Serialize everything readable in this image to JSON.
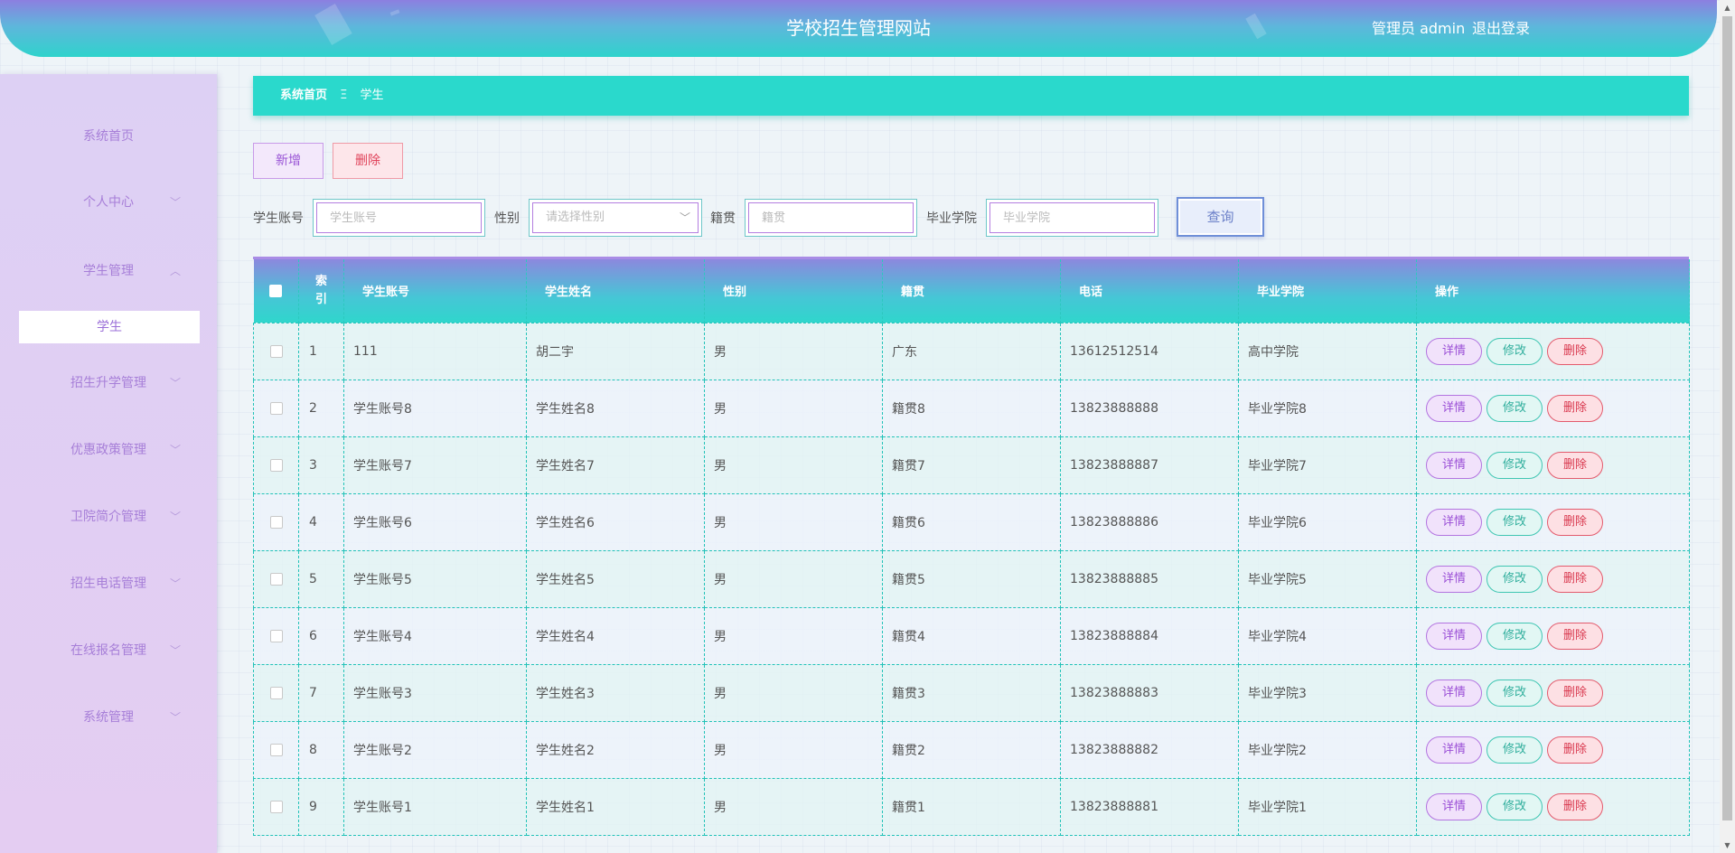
{
  "header": {
    "title": "学校招生管理网站",
    "user": "管理员 admin",
    "logout": "退出登录"
  },
  "sidebar": {
    "items": [
      {
        "label": "系统首页",
        "expandable": false
      },
      {
        "label": "个人中心",
        "expandable": true,
        "expanded": false
      },
      {
        "label": "学生管理",
        "expandable": true,
        "expanded": true
      },
      {
        "label": "招生升学管理",
        "expandable": true,
        "expanded": false
      },
      {
        "label": "优惠政策管理",
        "expandable": true,
        "expanded": false
      },
      {
        "label": "卫院简介管理",
        "expandable": true,
        "expanded": false
      },
      {
        "label": "招生电话管理",
        "expandable": true,
        "expanded": false
      },
      {
        "label": "在线报名管理",
        "expandable": true,
        "expanded": false
      },
      {
        "label": "系统管理",
        "expandable": true,
        "expanded": false
      }
    ],
    "active_sub": "学生"
  },
  "breadcrumb": {
    "home": "系统首页",
    "separator": "Ξ",
    "current": "学生"
  },
  "actions": {
    "add": "新增",
    "delete": "删除"
  },
  "search": {
    "account_label": "学生账号",
    "account_placeholder": "学生账号",
    "gender_label": "性别",
    "gender_placeholder": "请选择性别",
    "native_label": "籍贯",
    "native_placeholder": "籍贯",
    "college_label": "毕业学院",
    "college_placeholder": "毕业学院",
    "query": "查询"
  },
  "table": {
    "columns": {
      "index": "索引",
      "account": "学生账号",
      "name": "学生姓名",
      "gender": "性别",
      "native": "籍贯",
      "phone": "电话",
      "college": "毕业学院",
      "ops": "操作"
    },
    "ops": {
      "detail": "详情",
      "edit": "修改",
      "remove": "删除"
    },
    "rows": [
      {
        "index": "1",
        "account": "111",
        "name": "胡二宇",
        "gender": "男",
        "native": "广东",
        "phone": "13612512514",
        "college": "高中学院"
      },
      {
        "index": "2",
        "account": "学生账号8",
        "name": "学生姓名8",
        "gender": "男",
        "native": "籍贯8",
        "phone": "13823888888",
        "college": "毕业学院8"
      },
      {
        "index": "3",
        "account": "学生账号7",
        "name": "学生姓名7",
        "gender": "男",
        "native": "籍贯7",
        "phone": "13823888887",
        "college": "毕业学院7"
      },
      {
        "index": "4",
        "account": "学生账号6",
        "name": "学生姓名6",
        "gender": "男",
        "native": "籍贯6",
        "phone": "13823888886",
        "college": "毕业学院6"
      },
      {
        "index": "5",
        "account": "学生账号5",
        "name": "学生姓名5",
        "gender": "男",
        "native": "籍贯5",
        "phone": "13823888885",
        "college": "毕业学院5"
      },
      {
        "index": "6",
        "account": "学生账号4",
        "name": "学生姓名4",
        "gender": "男",
        "native": "籍贯4",
        "phone": "13823888884",
        "college": "毕业学院4"
      },
      {
        "index": "7",
        "account": "学生账号3",
        "name": "学生姓名3",
        "gender": "男",
        "native": "籍贯3",
        "phone": "13823888883",
        "college": "毕业学院3"
      },
      {
        "index": "8",
        "account": "学生账号2",
        "name": "学生姓名2",
        "gender": "男",
        "native": "籍贯2",
        "phone": "13823888882",
        "college": "毕业学院2"
      },
      {
        "index": "9",
        "account": "学生账号1",
        "name": "学生姓名1",
        "gender": "男",
        "native": "籍贯1",
        "phone": "13823888881",
        "college": "毕业学院1"
      }
    ]
  },
  "icons": {
    "chevron": "chevron-down-icon",
    "select_arrow": "chevron-down-icon"
  }
}
